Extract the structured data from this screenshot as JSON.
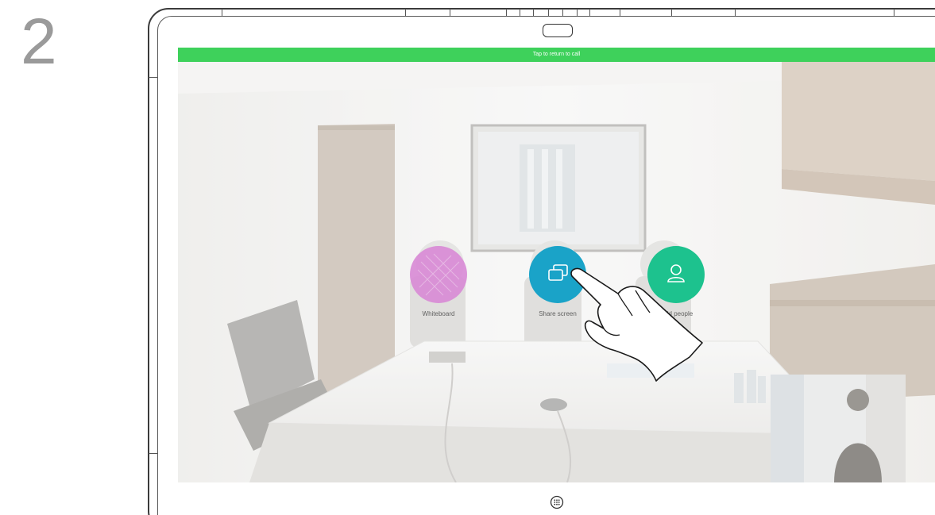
{
  "step": {
    "number": "2"
  },
  "screen": {
    "return_bar": {
      "label": "Tap to return to call",
      "color": "#3ed15b"
    }
  },
  "actions": [
    {
      "label": "Whiteboard",
      "color": "#d98ad6",
      "icon": "whiteboard-icon"
    },
    {
      "label": "Share screen",
      "color": "#1aa3c8",
      "icon": "share-screen-icon"
    },
    {
      "label": "Add people",
      "color": "#1dc28e",
      "icon": "person-icon"
    }
  ],
  "device": {
    "home_icon": "home-grid-icon",
    "camera_icon": "camera-pill-icon"
  }
}
